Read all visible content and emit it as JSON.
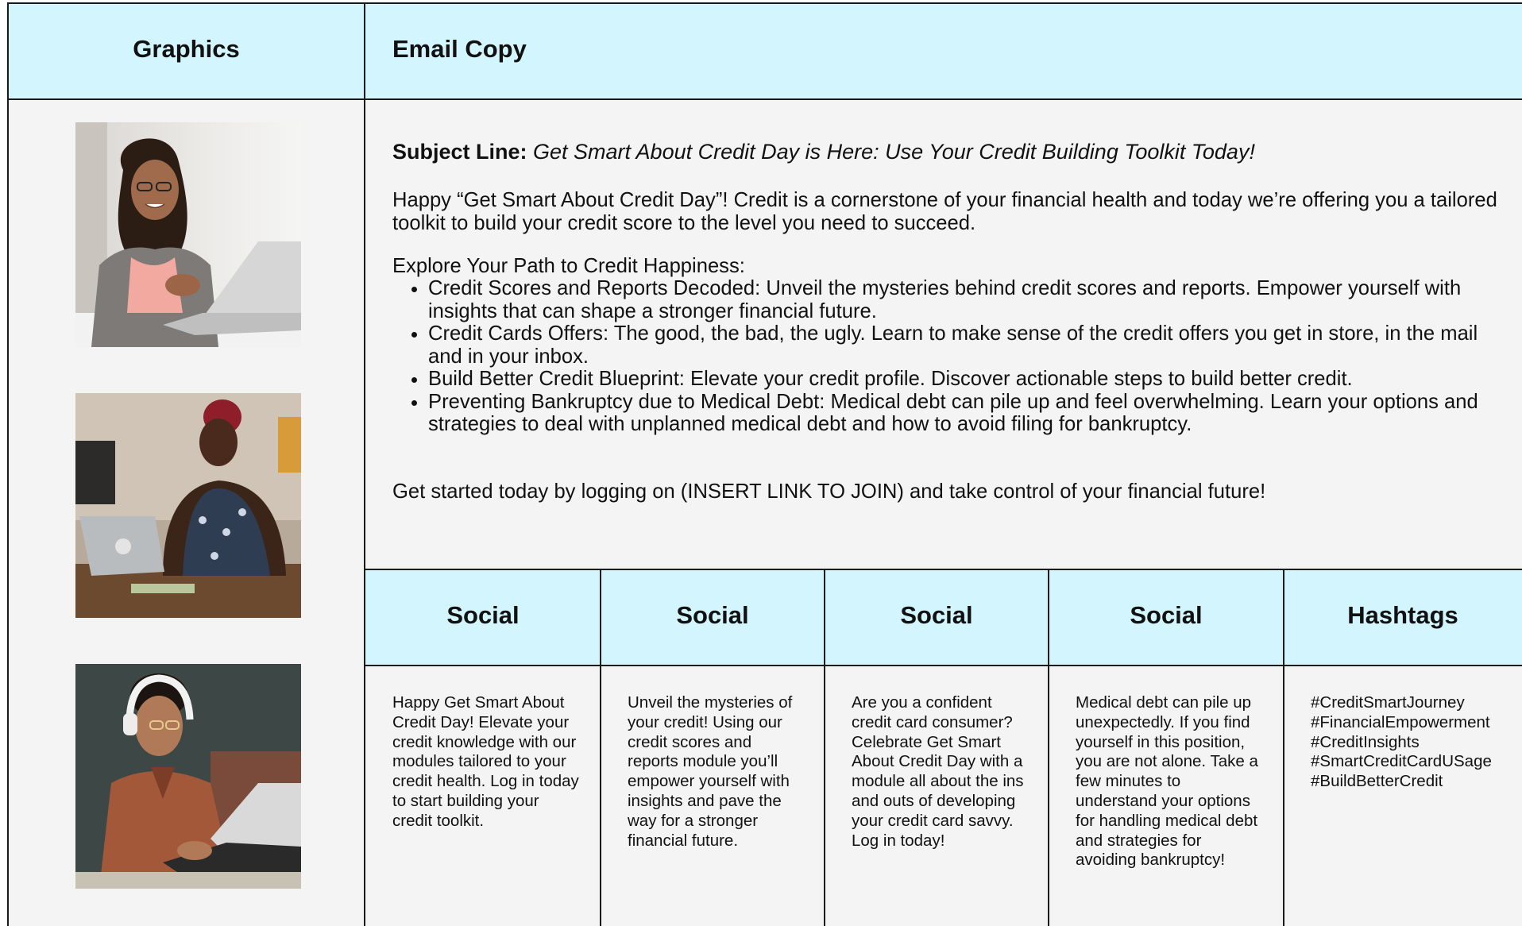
{
  "headers": {
    "graphics": "Graphics",
    "email_copy": "Email Copy",
    "social_1": "Social",
    "social_2": "Social",
    "social_3": "Social",
    "social_4": "Social",
    "hashtags": "Hashtags"
  },
  "email": {
    "subject_label": "Subject Line:",
    "subject_value": " Get Smart About Credit Day is Here: Use Your Credit Building Toolkit Today!",
    "intro": "Happy “Get Smart About Credit Day”! Credit is a cornerstone of your financial health and today we’re offering you a tailored toolkit to build your credit score to the level you need to succeed.",
    "explore": "Explore Your Path to Credit Happiness:",
    "bullets": [
      "Credit Scores and Reports Decoded: Unveil the mysteries behind credit scores and reports. Empower yourself with insights that can shape a stronger financial future.",
      "Credit Cards Offers: The good, the bad, the ugly.  Learn to make sense of the credit offers you get in store, in the mail and in your inbox.",
      "Build Better Credit Blueprint: Elevate your credit profile.  Discover actionable steps to build better credit.",
      "Preventing Bankruptcy due to Medical Debt: Medical debt can pile up and feel overwhelming.  Learn your options and strategies to deal with unplanned medical debt and how to avoid filing for bankruptcy."
    ],
    "cta": "Get started today by logging on (INSERT LINK TO JOIN) and take control of your financial future!"
  },
  "social": {
    "post_1": "Happy Get Smart About Credit Day! Elevate your credit knowledge with our modules tailored to your credit health.  Log in today to start building your credit toolkit.",
    "post_2": "Unveil the mysteries of your credit! Using our credit scores and reports module you’ll empower yourself with insights and pave the way for a stronger financial future.",
    "post_3": "Are you a confident credit card consumer? Celebrate Get Smart About Credit Day with a module all about the ins and outs of developing your credit card savvy. Log in today!",
    "post_4": "Medical debt can pile up unexpectedly.  If you find yourself in this position, you are not alone.  Take a few minutes to understand your options for handling medical debt and strategies for avoiding bankruptcy!"
  },
  "hashtags": [
    "#CreditSmartJourney",
    "#FinancialEmpowerment",
    "#CreditInsights",
    "#SmartCreditCardUSage",
    "#BuildBetterCredit"
  ],
  "colors": {
    "header_bg": "#d3f5fd",
    "body_bg": "#f4f4f4",
    "border": "#1a1a1a"
  },
  "graphics": [
    "photo-woman-smiling-laptop",
    "photo-woman-laptop-table",
    "photo-man-headphones-laptop"
  ]
}
